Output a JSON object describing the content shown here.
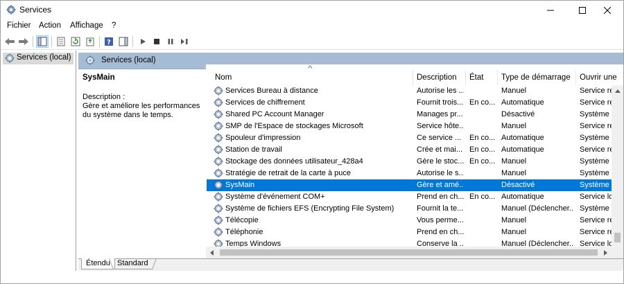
{
  "window": {
    "title": "Services",
    "icon": "gear-icon"
  },
  "menu": [
    "Fichier",
    "Action",
    "Affichage",
    "?"
  ],
  "toolbar": {
    "buttons": [
      "back-arrow-icon",
      "forward-arrow-icon",
      "show-hide-console-tree-icon",
      "properties-icon",
      "refresh-icon",
      "export-list-icon",
      "help-icon",
      "show-hide-action-pane-icon",
      "play-icon",
      "stop-icon",
      "pause-icon",
      "restart-icon"
    ]
  },
  "tree": {
    "root_label": "Services (local)"
  },
  "header": {
    "label": "Services (local)"
  },
  "details": {
    "title": "SysMain",
    "desc_label": "Description :",
    "desc_text": "Gère et améliore les performances du système dans le temps."
  },
  "list": {
    "columns": [
      "Nom",
      "Description",
      "État",
      "Type de démarrage",
      "Ouvrir une"
    ],
    "rows": [
      {
        "name": "Services Bureau à distance",
        "desc": "Autorise les ...",
        "state": "",
        "startup": "Manuel",
        "logon": "Service rése"
      },
      {
        "name": "Services de chiffrement",
        "desc": "Fournit trois...",
        "state": "En co...",
        "startup": "Automatique",
        "logon": "Service rése"
      },
      {
        "name": "Shared PC Account Manager",
        "desc": "Manages pr...",
        "state": "",
        "startup": "Désactivé",
        "logon": "Système loc"
      },
      {
        "name": "SMP de l'Espace de stockages Microsoft",
        "desc": "Service hôte...",
        "state": "",
        "startup": "Manuel",
        "logon": "Service rése"
      },
      {
        "name": "Spouleur d'impression",
        "desc": "Ce service ...",
        "state": "En co...",
        "startup": "Automatique",
        "logon": "Système loc"
      },
      {
        "name": "Station de travail",
        "desc": "Crée et mai...",
        "state": "En co...",
        "startup": "Automatique",
        "logon": "Service rése"
      },
      {
        "name": "Stockage des données utilisateur_428a4",
        "desc": "Gère le stoc...",
        "state": "En co...",
        "startup": "Manuel",
        "logon": "Système loc"
      },
      {
        "name": "Stratégie de retrait de la carte à puce",
        "desc": "Autorise le s...",
        "state": "",
        "startup": "Manuel",
        "logon": "Système loc"
      },
      {
        "name": "SysMain",
        "desc": "Gère et amé...",
        "state": "",
        "startup": "Désactivé",
        "logon": "Système loc",
        "selected": true
      },
      {
        "name": "Système d'événement COM+",
        "desc": "Prend en ch...",
        "state": "En co...",
        "startup": "Automatique",
        "logon": "Service loca"
      },
      {
        "name": "Système de fichiers EFS (Encrypting File System)",
        "desc": "Fournit la te...",
        "state": "",
        "startup": "Manuel (Déclencher...",
        "logon": "Système loc"
      },
      {
        "name": "Télécopie",
        "desc": "Vous perme...",
        "state": "",
        "startup": "Manuel",
        "logon": "Service rése"
      },
      {
        "name": "Téléphonie",
        "desc": "Prend en ch...",
        "state": "",
        "startup": "Manuel",
        "logon": "Service rése"
      },
      {
        "name": "Temps Windows",
        "desc": "Conserve la ...",
        "state": "",
        "startup": "Manuel (Déclencher...",
        "logon": "Service loca"
      }
    ]
  },
  "tabs": {
    "extended": "Étendu",
    "standard": "Standard"
  },
  "colors": {
    "selection": "#0078d7",
    "header_band": "#a6bcd5"
  }
}
